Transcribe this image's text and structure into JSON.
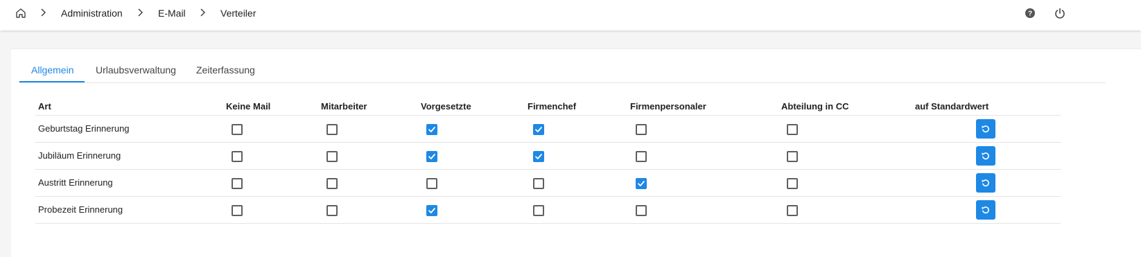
{
  "breadcrumb": {
    "home_icon": "home-icon",
    "items": [
      "Administration",
      "E-Mail",
      "Verteiler"
    ],
    "separator_icon": "chevron-right-icon"
  },
  "topbar": {
    "help_icon": "help-circle-icon",
    "power_icon": "power-icon"
  },
  "tabs": [
    {
      "label": "Allgemein",
      "active": true
    },
    {
      "label": "Urlaubsverwaltung",
      "active": false
    },
    {
      "label": "Zeiterfassung",
      "active": false
    }
  ],
  "table": {
    "columns": [
      "Art",
      "Keine Mail",
      "Mitarbeiter",
      "Vorgesetzte",
      "Firmenchef",
      "Firmenpersonaler",
      "Abteilung in CC",
      "auf Standardwert"
    ],
    "rows": [
      {
        "label": "Geburtstag Erinnerung",
        "checks": [
          false,
          false,
          true,
          true,
          false,
          false
        ]
      },
      {
        "label": "Jubiläum Erinnerung",
        "checks": [
          false,
          false,
          true,
          true,
          false,
          false
        ]
      },
      {
        "label": "Austritt Erinnerung",
        "checks": [
          false,
          false,
          false,
          false,
          true,
          false
        ]
      },
      {
        "label": "Probezeit Erinnerung",
        "checks": [
          false,
          false,
          true,
          false,
          false,
          false
        ]
      }
    ],
    "reset_icon": "reset-icon"
  },
  "colors": {
    "accent": "#1e88e5",
    "checkbox_border": "#5f5f5f",
    "divider": "#e4e4e4"
  }
}
